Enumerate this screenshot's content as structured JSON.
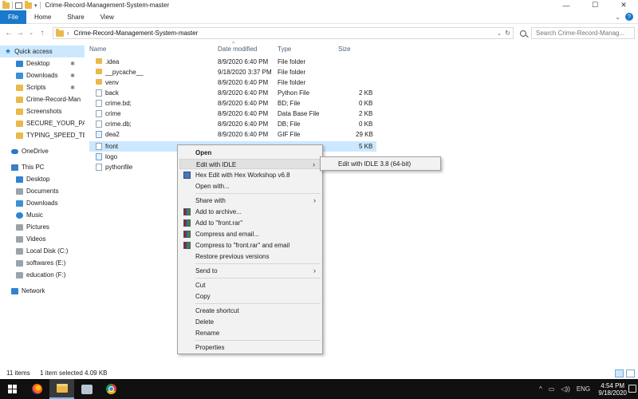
{
  "window": {
    "title": "Crime-Record-Management-System-master",
    "controls": [
      "—",
      "☐",
      "✕"
    ]
  },
  "ribbon": {
    "file_tab": "File",
    "tabs": [
      "Home",
      "Share",
      "View"
    ],
    "expand_symbol": "⌄",
    "help_symbol": "?"
  },
  "address": {
    "path_sep": "›",
    "path": "Crime-Record-Management-System-master",
    "search_placeholder": "Search Crime-Record-Manag..."
  },
  "nav": [
    {
      "label": "Quick access",
      "icon": "star-icon",
      "selected": true
    },
    {
      "label": "Desktop",
      "icon": "desktop-icon",
      "pinned": true
    },
    {
      "label": "Downloads",
      "icon": "downloads-icon",
      "pinned": true
    },
    {
      "label": "Scripts",
      "icon": "folder-icon",
      "pinned": true
    },
    {
      "label": "Crime-Record-Man",
      "icon": "folder-icon"
    },
    {
      "label": "Screenshots",
      "icon": "folder-icon"
    },
    {
      "label": "SECURE_YOUR_PAS",
      "icon": "folder-icon"
    },
    {
      "label": "TYPING_SPEED_TES",
      "icon": "folder-icon"
    },
    {
      "label": "OneDrive",
      "icon": "cloud-icon"
    },
    {
      "label": "This PC",
      "icon": "pc-icon"
    },
    {
      "label": "Desktop",
      "icon": "desktop-icon"
    },
    {
      "label": "Documents",
      "icon": "documents-icon"
    },
    {
      "label": "Downloads",
      "icon": "downloads-icon"
    },
    {
      "label": "Music",
      "icon": "music-icon"
    },
    {
      "label": "Pictures",
      "icon": "pictures-icon"
    },
    {
      "label": "Videos",
      "icon": "videos-icon"
    },
    {
      "label": "Local Disk (C:)",
      "icon": "drive-icon"
    },
    {
      "label": "softwares (E:)",
      "icon": "drive-icon"
    },
    {
      "label": "education (F:)",
      "icon": "drive-icon"
    },
    {
      "label": "Network",
      "icon": "network-icon"
    }
  ],
  "columns": {
    "name": "Name",
    "date": "Date modified",
    "type": "Type",
    "size": "Size",
    "sort_symbol": "^"
  },
  "files": [
    {
      "name": ".idea",
      "date": "8/9/2020 6:40 PM",
      "type": "File folder",
      "size": "",
      "icon": "folder-icon"
    },
    {
      "name": "__pycache__",
      "date": "9/18/2020 3:37 PM",
      "type": "File folder",
      "size": "",
      "icon": "folder-icon"
    },
    {
      "name": "venv",
      "date": "8/9/2020 6:40 PM",
      "type": "File folder",
      "size": "",
      "icon": "folder-icon"
    },
    {
      "name": "back",
      "date": "8/9/2020 6:40 PM",
      "type": "Python File",
      "size": "2 KB",
      "icon": "python-file-icon"
    },
    {
      "name": "crime.bd;",
      "date": "8/9/2020 6:40 PM",
      "type": "BD; File",
      "size": "0 KB",
      "icon": "file-icon"
    },
    {
      "name": "crime",
      "date": "8/9/2020 6:40 PM",
      "type": "Data Base File",
      "size": "2 KB",
      "icon": "file-icon"
    },
    {
      "name": "crime.db;",
      "date": "8/9/2020 6:40 PM",
      "type": "DB; File",
      "size": "0 KB",
      "icon": "file-icon"
    },
    {
      "name": "dea2",
      "date": "8/9/2020 6:40 PM",
      "type": "GIF File",
      "size": "29 KB",
      "icon": "gif-file-icon"
    },
    {
      "name": "front",
      "date": "",
      "type": "",
      "size": "5 KB",
      "icon": "python-file-icon",
      "selected": true
    },
    {
      "name": "logo",
      "date": "",
      "type": "",
      "size": "",
      "icon": "gif-file-icon"
    },
    {
      "name": "pythonfile",
      "date": "",
      "type": "",
      "size": "",
      "icon": "python-file-icon"
    }
  ],
  "context_menu": {
    "items": [
      {
        "label": "Open",
        "bold": true
      },
      {
        "label": "Edit with IDLE",
        "submenu": true,
        "hover": true
      },
      {
        "label": "Hex Edit with Hex Workshop v6.8",
        "icon": "hex-icon"
      },
      {
        "label": "Open with..."
      },
      {
        "label": "Share with",
        "submenu": true
      },
      {
        "label": "Add to archive...",
        "icon": "rar-icon"
      },
      {
        "label": "Add to \"front.rar\"",
        "icon": "rar-icon"
      },
      {
        "label": "Compress and email...",
        "icon": "rar-icon"
      },
      {
        "label": "Compress to \"front.rar\" and email",
        "icon": "rar-icon"
      },
      {
        "label": "Restore previous versions"
      },
      {
        "label": "Send to",
        "submenu": true
      },
      {
        "label": "Cut"
      },
      {
        "label": "Copy"
      },
      {
        "label": "Create shortcut"
      },
      {
        "label": "Delete"
      },
      {
        "label": "Rename"
      },
      {
        "label": "Properties"
      }
    ],
    "submenu_arrow": "›",
    "submenu_item": "Edit with IDLE 3.8 (64-bit)"
  },
  "status": {
    "items": "11 items",
    "selected": "1 item selected  4.09 KB"
  },
  "taskbar": {
    "apps": [
      "start-button",
      "firefox-icon",
      "file-explorer-icon",
      "snipping-tool-icon",
      "chrome-icon"
    ],
    "tray_symbols": [
      "^",
      "▭",
      "◁))",
      "ENG"
    ],
    "time": "4:54 PM",
    "date": "9/18/2020"
  },
  "colors": {
    "accent": "#1979ca",
    "selection": "#cce8ff",
    "folder": "#e9b949",
    "taskbar": "#101010"
  }
}
